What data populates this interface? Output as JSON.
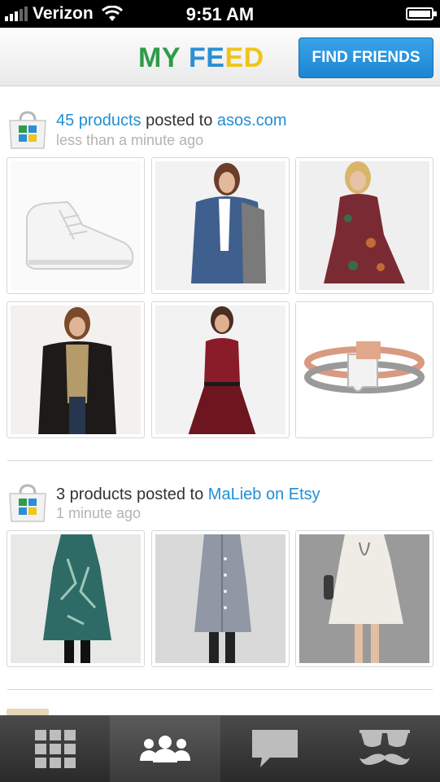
{
  "status_bar": {
    "carrier": "Verizon",
    "time": "9:51 AM",
    "battery_level": 0.9
  },
  "header": {
    "title_letters": [
      {
        "char": "M",
        "color": "#2e9b4a"
      },
      {
        "char": "Y",
        "color": "#2e9b4a"
      },
      {
        "char": " ",
        "color": "#2e9b4a"
      },
      {
        "char": "F",
        "color": "#2a8fd6"
      },
      {
        "char": "E",
        "color": "#2a8fd6"
      },
      {
        "char": "E",
        "color": "#f0c419"
      },
      {
        "char": "D",
        "color": "#f0c419"
      }
    ],
    "find_friends_label": "FIND FRIENDS"
  },
  "feed": [
    {
      "count_text": "45 products",
      "middle_text": " posted to ",
      "store_text": "asos.com",
      "time_text": "less than a minute ago",
      "products": [
        {
          "icon": "high-top-sneaker"
        },
        {
          "icon": "denim-jacket-model"
        },
        {
          "icon": "floral-dress-model"
        },
        {
          "icon": "black-cardigan-model"
        },
        {
          "icon": "red-dress-model"
        },
        {
          "icon": "puzzle-ring"
        }
      ]
    },
    {
      "count_text": "3 products",
      "middle_text": " posted to ",
      "store_text": "MaLieb on Etsy",
      "time_text": "1 minute ago",
      "products": [
        {
          "icon": "teal-print-tunic-model"
        },
        {
          "icon": "grey-shirt-dress-model"
        },
        {
          "icon": "white-tunic-model"
        }
      ]
    }
  ],
  "tab_bar": {
    "tabs": [
      {
        "name": "grid-icon",
        "active": false
      },
      {
        "name": "friends-icon",
        "active": true
      },
      {
        "name": "chat-icon",
        "active": false
      },
      {
        "name": "profile-mustache-icon",
        "active": false
      }
    ]
  },
  "colors": {
    "accent_blue": "#1f8fd6",
    "title_green": "#2e9b4a",
    "title_yellow": "#f0c419"
  }
}
